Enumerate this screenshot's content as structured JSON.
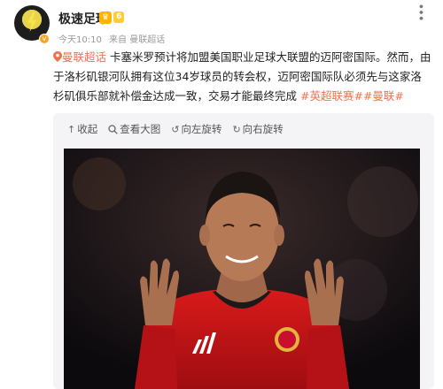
{
  "account": {
    "name": "极速足球",
    "vip_level": "6",
    "avatar_badge": "v"
  },
  "meta": {
    "time": "今天10:10",
    "source": "来自 曼联超话"
  },
  "post": {
    "location": "曼联超话",
    "body": "卡塞米罗预计将加盟美国职业足球大联盟的迈阿密国际。然而，由于洛杉矶银河队拥有这位34岁球员的转会权，迈阿密国际队必须先与这家洛杉矶俱乐部就补偿金达成一致，交易才能最终完成",
    "tags": [
      "#英超联赛#",
      "#曼联#"
    ]
  },
  "toolbar": {
    "collapse": "收起",
    "view_large": "查看大图",
    "rotate_left": "向左旋转",
    "rotate_right": "向右旋转"
  },
  "icons": {
    "collapse": "collapse-icon",
    "view_large": "search-icon",
    "rotate_left": "rotate-left-icon",
    "rotate_right": "rotate-right-icon"
  },
  "colors": {
    "accent": "#eb7350",
    "vip": "#ffb400"
  }
}
